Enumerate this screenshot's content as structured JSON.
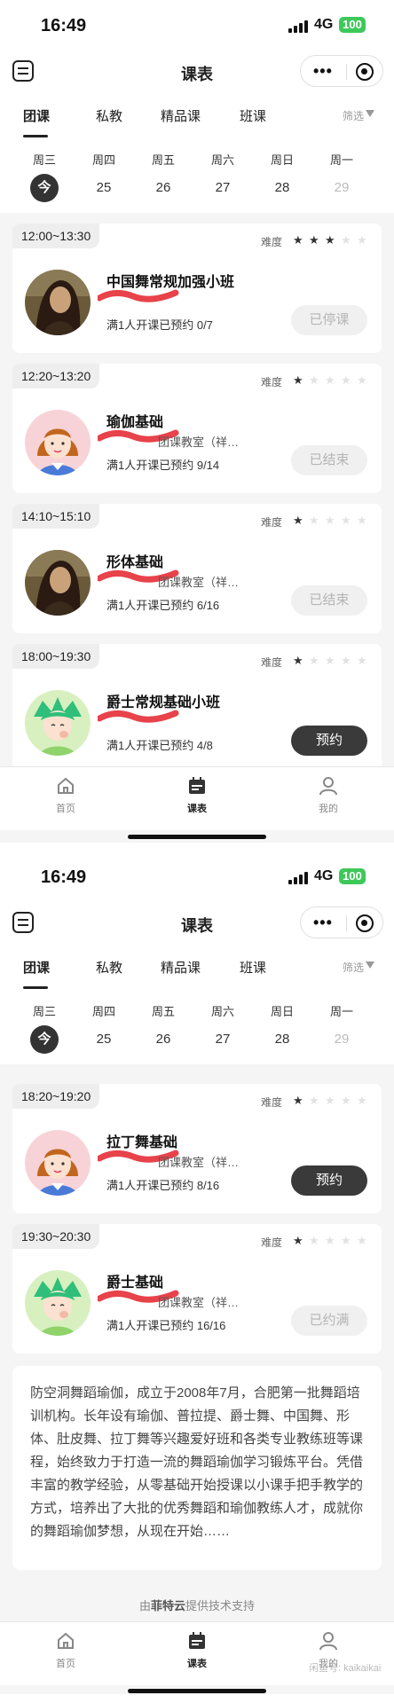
{
  "status_bar": {
    "time": "16:49",
    "network": "4G",
    "battery": "100"
  },
  "navbar": {
    "title": "课表"
  },
  "tabs": {
    "items": [
      "团课",
      "私教",
      "精品课",
      "班课"
    ],
    "active": 0,
    "filter_label": "筛选"
  },
  "dates": [
    {
      "weekday": "周三",
      "day": "今",
      "state": "today"
    },
    {
      "weekday": "周四",
      "day": "25",
      "state": "normal"
    },
    {
      "weekday": "周五",
      "day": "26",
      "state": "normal"
    },
    {
      "weekday": "周六",
      "day": "27",
      "state": "normal"
    },
    {
      "weekday": "周日",
      "day": "28",
      "state": "normal"
    },
    {
      "weekday": "周一",
      "day": "29",
      "state": "muted"
    }
  ],
  "difficulty_label": "难度",
  "screen1": {
    "classes": [
      {
        "time": "12:00~13:30",
        "difficulty": 3,
        "name": "中国舞常规加强小班",
        "room": "",
        "enrollment": "满1人开课已预约 0/7",
        "button": "已停课",
        "button_state": "disabled",
        "avatar": "photo"
      },
      {
        "time": "12:20~13:20",
        "difficulty": 1,
        "name": "瑜伽基础",
        "room": "团课教室（祥…",
        "enrollment": "满1人开课已预约 9/14",
        "button": "已结束",
        "button_state": "disabled",
        "avatar": "cartoon-woman"
      },
      {
        "time": "14:10~15:10",
        "difficulty": 1,
        "name": "形体基础",
        "room": "团课教室（祥…",
        "enrollment": "满1人开课已预约 6/16",
        "button": "已结束",
        "button_state": "disabled",
        "avatar": "photo"
      },
      {
        "time": "18:00~19:30",
        "difficulty": 1,
        "name": "爵士常规基础小班",
        "room": "",
        "enrollment": "满1人开课已预约 4/8",
        "button": "预约",
        "button_state": "primary",
        "avatar": "cartoon-girl"
      }
    ]
  },
  "screen2": {
    "classes": [
      {
        "time": "18:20~19:20",
        "difficulty": 1,
        "name": "拉丁舞基础",
        "room": "团课教室（祥…",
        "enrollment": "满1人开课已预约 8/16",
        "button": "预约",
        "button_state": "primary",
        "avatar": "cartoon-woman"
      },
      {
        "time": "19:30~20:30",
        "difficulty": 1,
        "name": "爵士基础",
        "room": "团课教室（祥…",
        "enrollment": "满1人开课已预约 16/16",
        "button": "已约满",
        "button_state": "disabled",
        "avatar": "cartoon-girl"
      }
    ],
    "about": "防空洞舞蹈瑜伽，成立于2008年7月，合肥第一批舞蹈培训机构。长年设有瑜伽、普拉提、爵士舞、中国舞、形体、肚皮舞、拉丁舞等兴趣爱好班和各类专业教练班等课程，始终致力于打造一流的舞蹈瑜伽学习锻炼平台。凭借丰富的教学经验，从零基础开始授课以小课手把手教学的方式，培养出了大批的优秀舞蹈和瑜伽教练人才，成就你的舞蹈瑜伽梦想，从现在开始……",
    "powered_prefix": "由",
    "powered_brand": "菲特云",
    "powered_suffix": "提供技术支持",
    "watermark": "闲鱼号: kaikaikai"
  },
  "tabbar": {
    "items": [
      {
        "label": "首页",
        "icon": "home-icon"
      },
      {
        "label": "课表",
        "icon": "calendar-icon"
      },
      {
        "label": "我的",
        "icon": "user-icon"
      }
    ],
    "active": 1
  },
  "colors": {
    "accent": "#3a3a3a",
    "battery": "#3fc85a",
    "disabled_bg": "#f0f0f0"
  }
}
